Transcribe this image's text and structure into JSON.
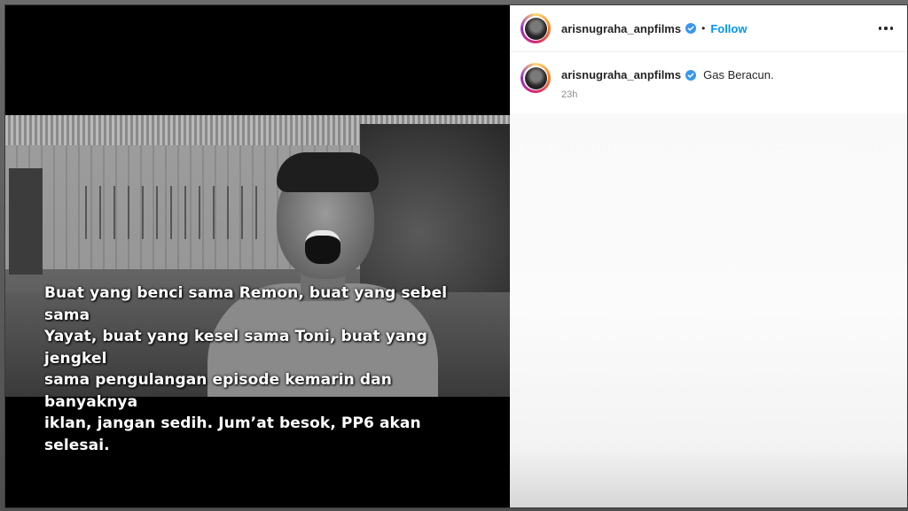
{
  "post": {
    "caption_lines": [
      "Buat yang benci sama Remon, buat yang sebel sama",
      "Yayat, buat yang kesel sama Toni, buat yang jengkel",
      "sama pengulangan episode kemarin dan banyaknya",
      "iklan, jangan sedih. Jum’at besok, PP6 akan selesai."
    ]
  },
  "header": {
    "username": "arisnugraha_anpfilms",
    "separator": "•",
    "follow_label": "Follow"
  },
  "comment": {
    "username": "arisnugraha_anpfilms",
    "text": "Gas Beracun.",
    "time": "23h"
  },
  "colors": {
    "accent": "#0095f6",
    "verified": "#3897f0"
  },
  "icons": {
    "more": "more-horizontal-icon",
    "verified": "verified-badge-icon"
  }
}
